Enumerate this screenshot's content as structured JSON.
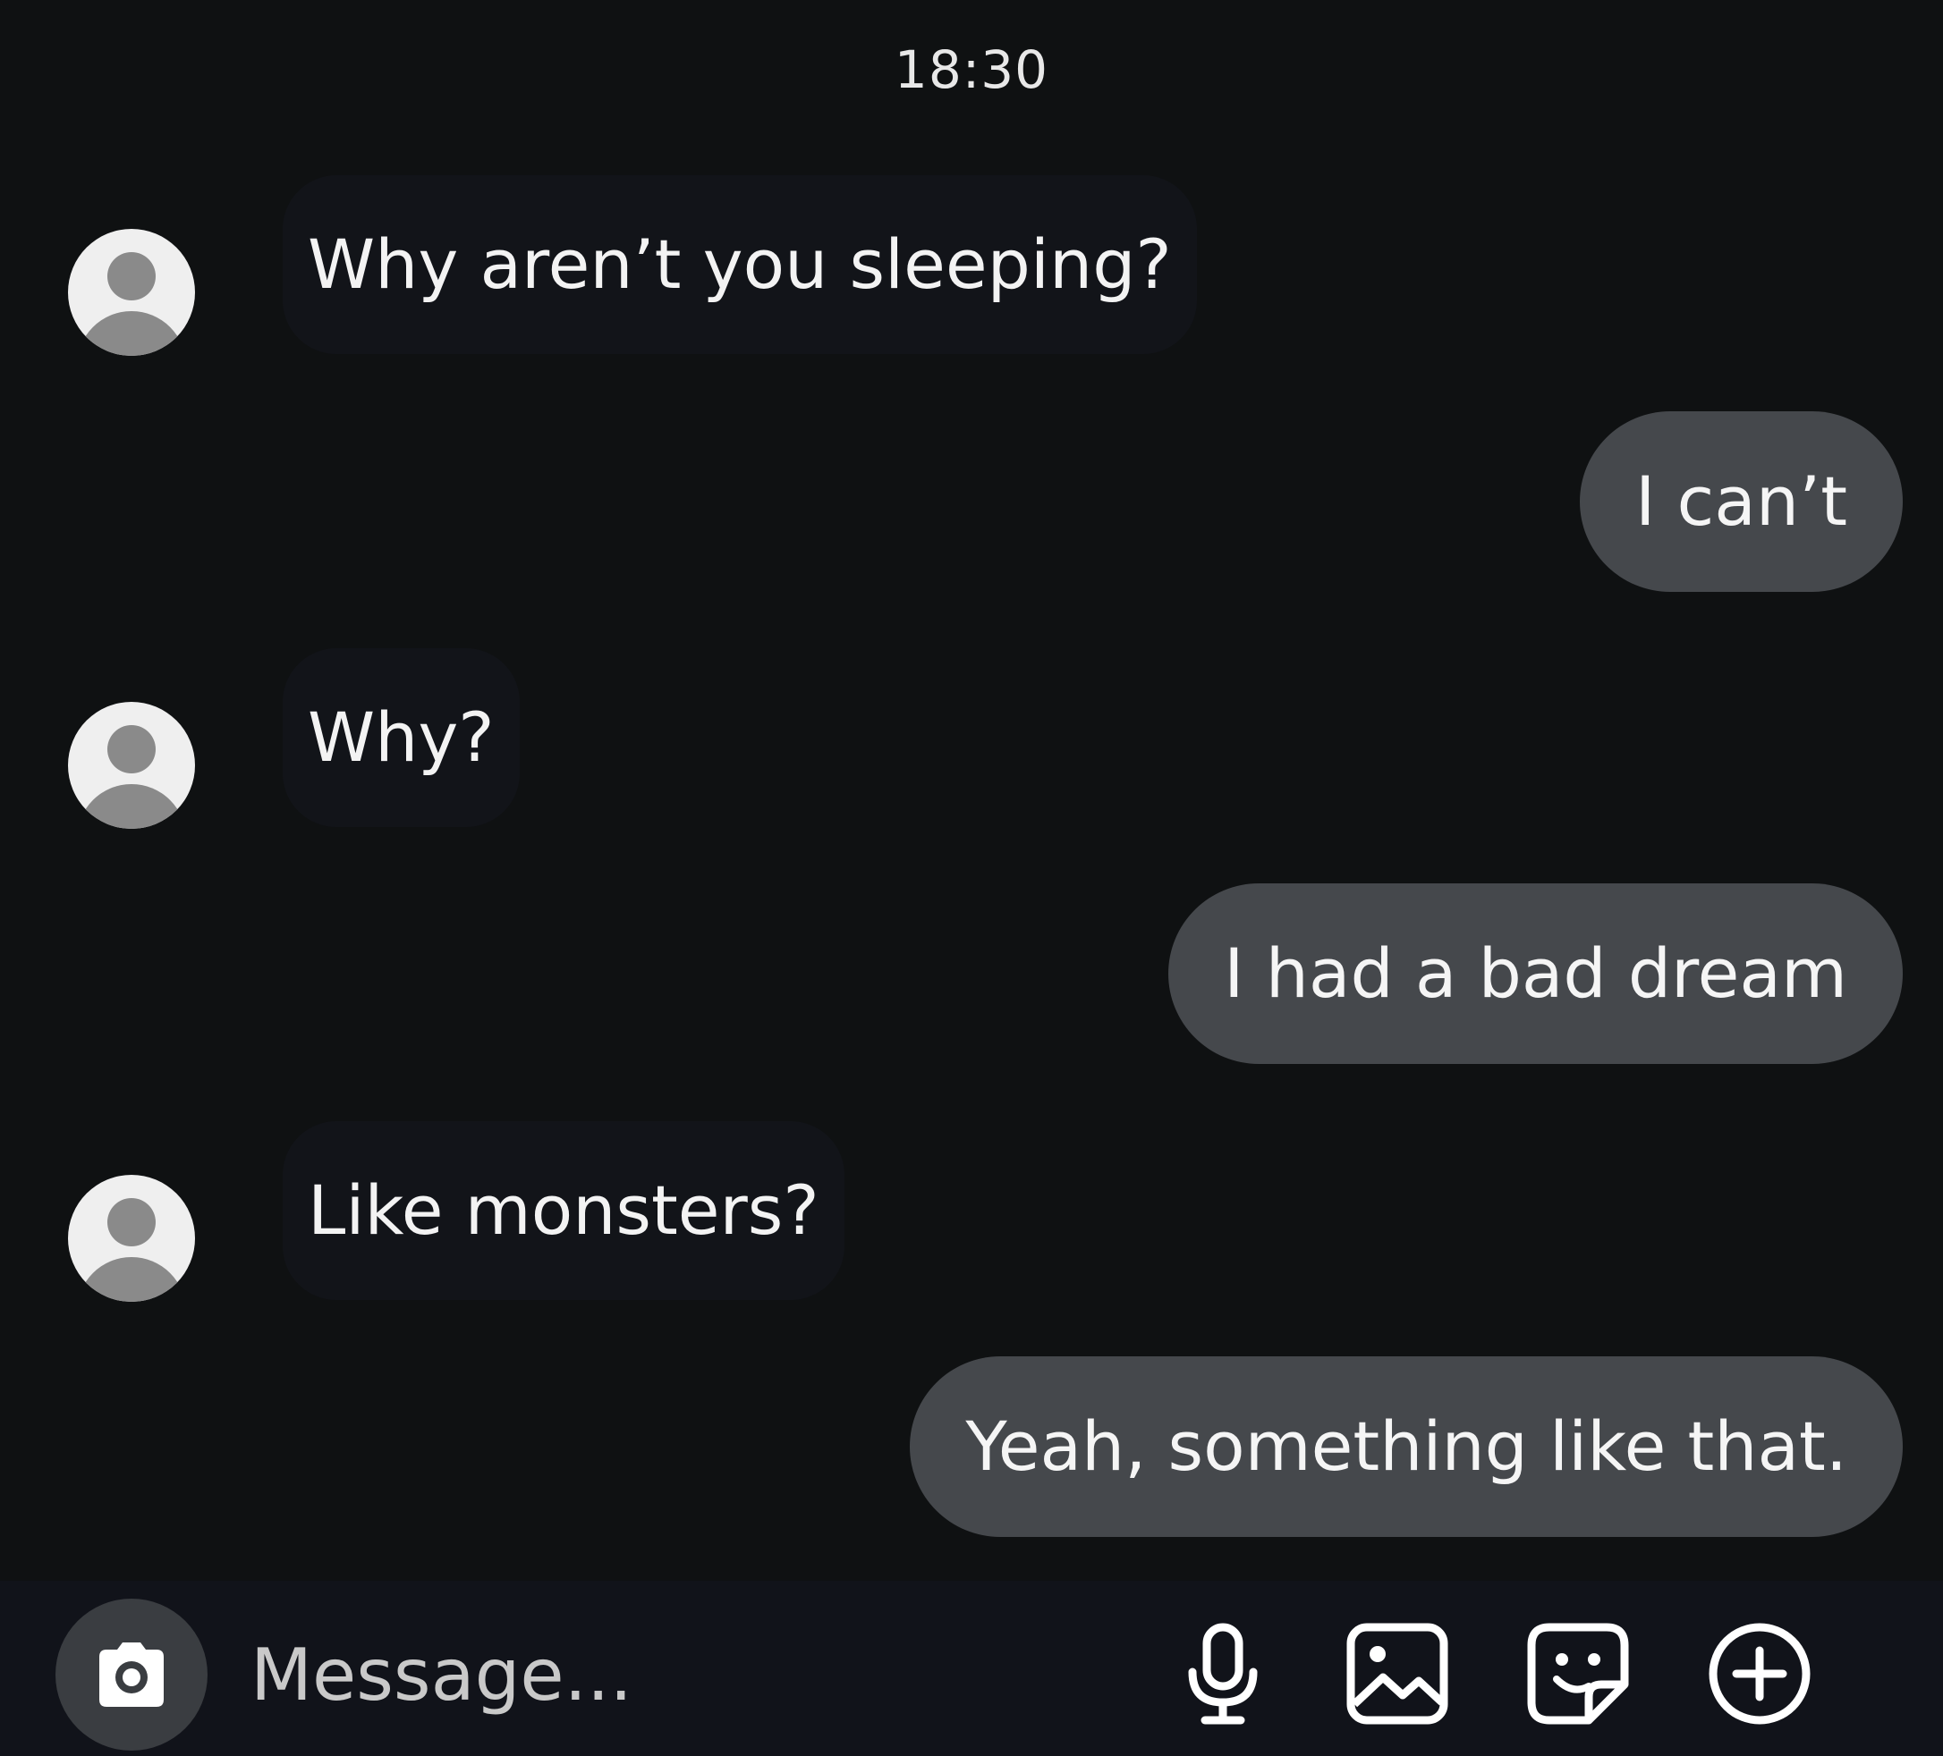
{
  "chat": {
    "timestamp": "18:30",
    "messages": [
      {
        "side": "incoming",
        "text": "Why aren’t you sleeping?"
      },
      {
        "side": "outgoing",
        "text": "I can’t"
      },
      {
        "side": "incoming",
        "text": "Why?"
      },
      {
        "side": "outgoing",
        "text": "I had a bad dream"
      },
      {
        "side": "incoming",
        "text": "Like monsters?"
      },
      {
        "side": "outgoing",
        "text": "Yeah, something like that."
      }
    ]
  },
  "composer": {
    "placeholder": "Message...",
    "icons": [
      "camera-icon",
      "microphone-icon",
      "gallery-icon",
      "sticker-icon",
      "add-icon"
    ]
  },
  "colors": {
    "background": "#0f1112",
    "outgoing_bubble": "#45484c",
    "text": "#f2f2f2",
    "avatar": "#efefef"
  }
}
